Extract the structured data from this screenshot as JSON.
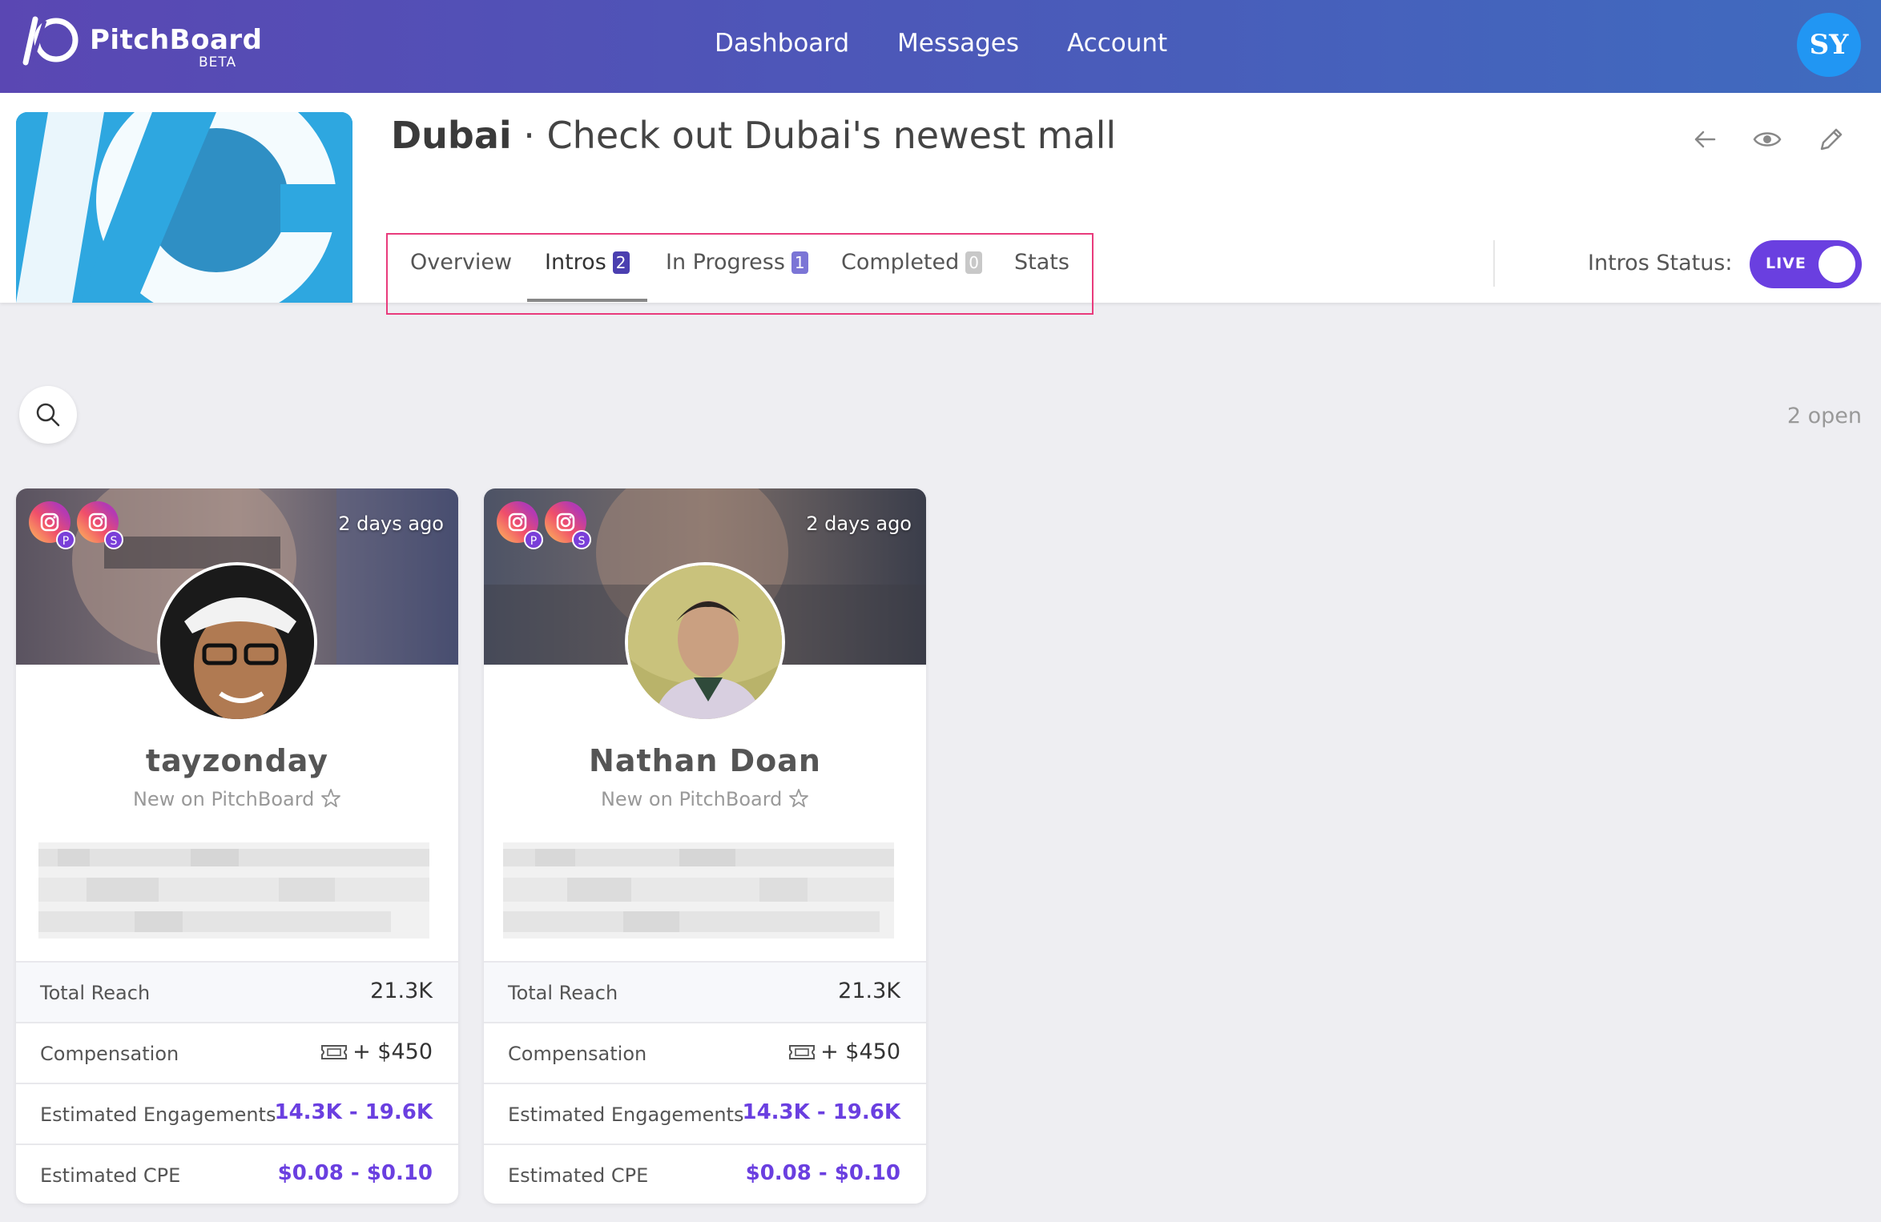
{
  "app": {
    "brand_name": "PitchBoard",
    "beta_label": "BETA",
    "nav": [
      "Dashboard",
      "Messages",
      "Account"
    ],
    "user_initials": "SY"
  },
  "campaign": {
    "location": "Dubai",
    "separator": " · ",
    "title": "Check out Dubai's newest mall"
  },
  "tabs": [
    {
      "label": "Overview",
      "badge": null
    },
    {
      "label": "Intros",
      "badge": "2"
    },
    {
      "label": "In Progress",
      "badge": "1"
    },
    {
      "label": "Completed",
      "badge": "0"
    },
    {
      "label": "Stats",
      "badge": null
    }
  ],
  "intros_status": {
    "label": "Intros Status:",
    "toggle_text": "LIVE"
  },
  "open_count": "2 open",
  "cards": [
    {
      "time_ago": "2 days ago",
      "social_badges": [
        "P",
        "S"
      ],
      "name": "tayzonday",
      "subtitle": "New on PitchBoard",
      "stats": {
        "total_reach_label": "Total Reach",
        "total_reach": "21.3K",
        "compensation_label": "Compensation",
        "compensation": "+ $450",
        "engagements_label": "Estimated Engagements",
        "engagements": "14.3K - 19.6K",
        "cpe_label": "Estimated CPE",
        "cpe": "$0.08 - $0.10"
      }
    },
    {
      "time_ago": "2 days ago",
      "social_badges": [
        "P",
        "S"
      ],
      "name": "Nathan Doan",
      "subtitle": "New on PitchBoard",
      "stats": {
        "total_reach_label": "Total Reach",
        "total_reach": "21.3K",
        "compensation_label": "Compensation",
        "compensation": "+ $450",
        "engagements_label": "Estimated Engagements",
        "engagements": "14.3K - 19.6K",
        "cpe_label": "Estimated CPE",
        "cpe": "$0.08 - $0.10"
      }
    }
  ],
  "colors": {
    "accent": "#6a3fe0",
    "highlight_border": "#e93b7c",
    "avatar_bg": "#2196f3",
    "badge_intros": "#4b3fb0",
    "badge_in_progress": "#7b75d6",
    "badge_completed": "#c8c8c8"
  },
  "icons": [
    "logo-icon",
    "back-arrow-icon",
    "eye-icon",
    "pencil-icon",
    "search-icon",
    "instagram-icon",
    "star-icon",
    "ticket-icon"
  ]
}
